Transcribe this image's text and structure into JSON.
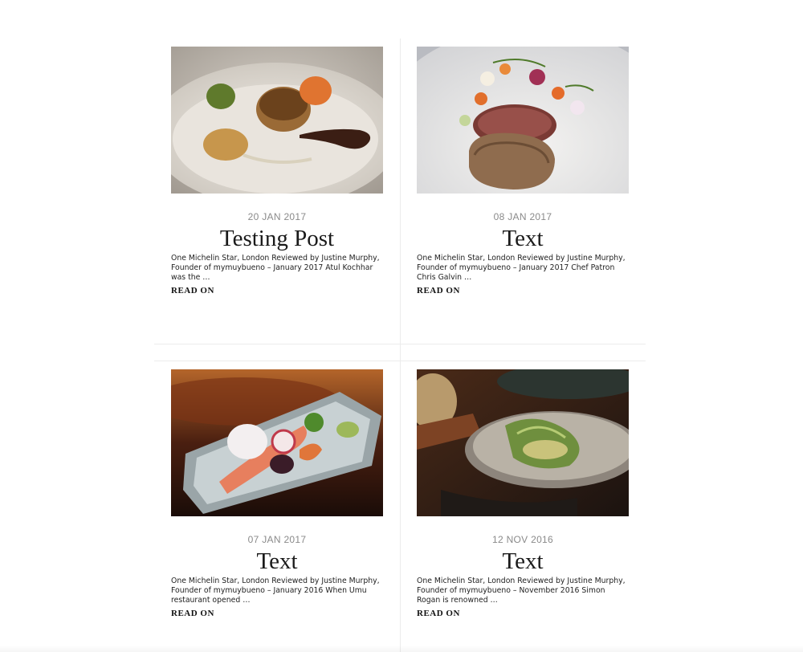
{
  "posts": [
    {
      "date": "20 JAN 2017",
      "title": "Testing Post",
      "excerpt": "One Michelin Star, London Reviewed by Justine Murphy, Founder of mymuybueno – January 2017 Atul Kochhar was the …",
      "read_more": "READ ON",
      "image_alt": "scallop-dish"
    },
    {
      "date": "08 JAN 2017",
      "title": "Text",
      "excerpt": "One Michelin Star, London  Reviewed by Justine Murphy, Founder of mymuybueno – January 2017 Chef Patron Chris Galvin …",
      "read_more": "READ ON",
      "image_alt": "tartare-dish"
    },
    {
      "date": "07 JAN 2017",
      "title": "Text",
      "excerpt": "One Michelin Star, London Reviewed by Justine Murphy, Founder of mymuybueno – January 2016 When Umu restaurant opened …",
      "read_more": "READ ON",
      "image_alt": "sashimi-dish"
    },
    {
      "date": "12 NOV 2016",
      "title": "Text",
      "excerpt": "One Michelin Star, London Reviewed by Justine Murphy, Founder of mymuybueno – November 2016 Simon Rogan is renowned …",
      "read_more": "READ ON",
      "image_alt": "herb-cracker-dish"
    }
  ]
}
